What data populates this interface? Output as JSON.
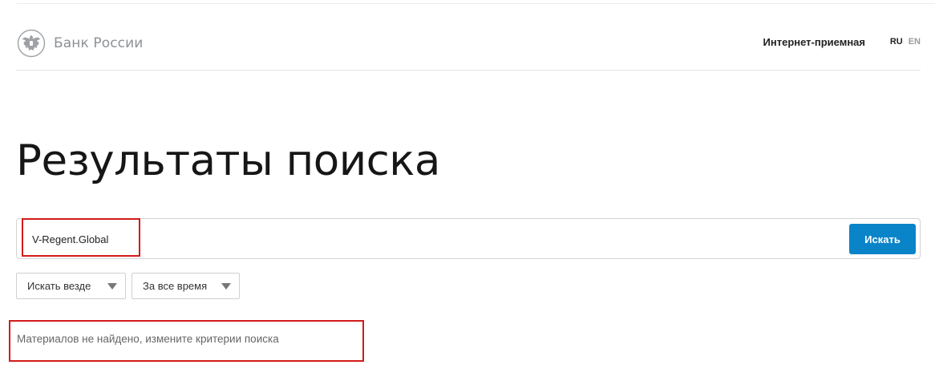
{
  "header": {
    "logo_text": "Банк России",
    "link_label": "Интернет-приемная",
    "lang_ru": "RU",
    "lang_en": "EN"
  },
  "main": {
    "title": "Результаты поиска",
    "search": {
      "value": "V-Regent.Global",
      "button_label": "Искать"
    },
    "filters": [
      {
        "label": "Искать везде"
      },
      {
        "label": "За все время"
      }
    ],
    "message": "Материалов не найдено, измените критерии поиска"
  },
  "colors": {
    "accent": "#0a84c8",
    "highlight": "#d31a1a",
    "logo": "#8d9195"
  }
}
